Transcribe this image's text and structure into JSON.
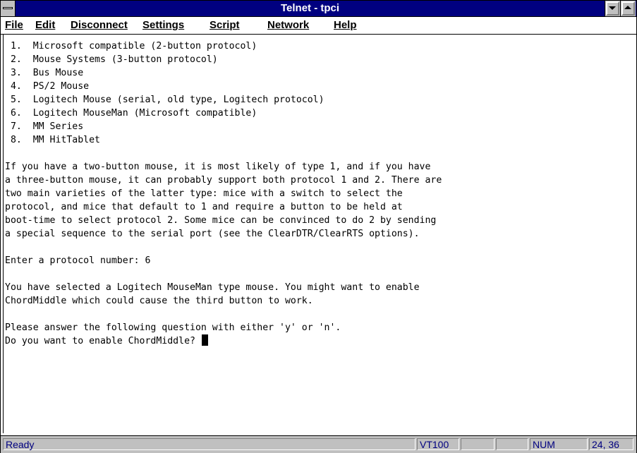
{
  "window": {
    "title": "Telnet - tpci"
  },
  "menubar": {
    "items": [
      {
        "underline": "F",
        "rest": "ile"
      },
      {
        "underline": "E",
        "rest": "dit"
      },
      {
        "underline": "D",
        "rest": "isconnect"
      },
      {
        "underline": "S",
        "rest": "ettings"
      },
      {
        "underline": "Scri",
        "rest": "pt"
      },
      {
        "underline": "N",
        "rest": "etwork"
      },
      {
        "underline": "H",
        "rest": "elp"
      }
    ]
  },
  "terminal": {
    "lines": [
      " 1.  Microsoft compatible (2-button protocol)",
      " 2.  Mouse Systems (3-button protocol)",
      " 3.  Bus Mouse",
      " 4.  PS/2 Mouse",
      " 5.  Logitech Mouse (serial, old type, Logitech protocol)",
      " 6.  Logitech MouseMan (Microsoft compatible)",
      " 7.  MM Series",
      " 8.  MM HitTablet",
      "",
      "If you have a two-button mouse, it is most likely of type 1, and if you have",
      "a three-button mouse, it can probably support both protocol 1 and 2. There are",
      "two main varieties of the latter type: mice with a switch to select the",
      "protocol, and mice that default to 1 and require a button to be held at",
      "boot-time to select protocol 2. Some mice can be convinced to do 2 by sending",
      "a special sequence to the serial port (see the ClearDTR/ClearRTS options).",
      "",
      "Enter a protocol number: 6",
      "",
      "You have selected a Logitech MouseMan type mouse. You might want to enable",
      "ChordMiddle which could cause the third button to work.",
      "",
      "Please answer the following question with either 'y' or 'n'.",
      "Do you want to enable ChordMiddle? "
    ]
  },
  "statusbar": {
    "status": "Ready",
    "terminal_type": "VT100",
    "blank": "",
    "num_lock": "NUM",
    "cursor_position": "24, 36"
  }
}
